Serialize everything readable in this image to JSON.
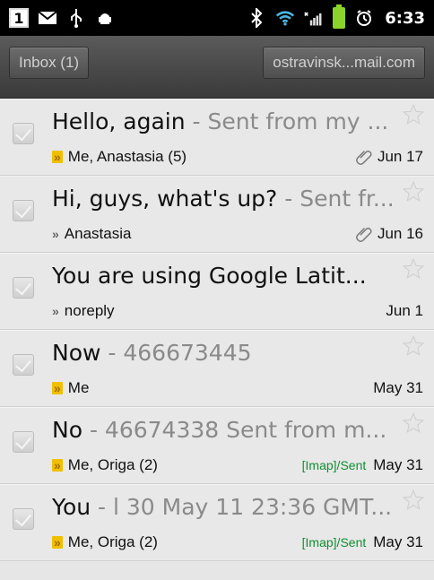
{
  "status": {
    "notif_count": "1",
    "time": "6:33"
  },
  "header": {
    "left_button": "Inbox (1)",
    "right_button": "ostravinsk...mail.com"
  },
  "messages": [
    {
      "subject": "Hello, again",
      "snippet": " - Sent from my ...",
      "senders": "Me, Anastasia (5)",
      "label": "",
      "attachment": true,
      "date": "Jun 17",
      "chevron": "highlight"
    },
    {
      "subject": "Hi, guys, what's up?",
      "snippet": " - Sent fr...",
      "senders": "Anastasia",
      "label": "",
      "attachment": true,
      "date": "Jun 16",
      "chevron": "plain"
    },
    {
      "subject": "You are using Google Latit...",
      "snippet": "",
      "senders": "noreply",
      "label": "",
      "attachment": false,
      "date": "Jun 1",
      "chevron": "plain"
    },
    {
      "subject": "Now",
      "snippet": " - 466673445",
      "senders": "Me",
      "label": "",
      "attachment": false,
      "date": "May 31",
      "chevron": "highlight"
    },
    {
      "subject": "No",
      "snippet": " - 46674338 Sent from m...",
      "senders": "Me, Origa (2)",
      "label": "[Imap]/Sent",
      "attachment": false,
      "date": "May 31",
      "chevron": "highlight"
    },
    {
      "subject": "You",
      "snippet": " - l 30 May 11 23:36 GMT...",
      "senders": "Me, Origa (2)",
      "label": "[Imap]/Sent",
      "attachment": false,
      "date": "May 31",
      "chevron": "highlight"
    }
  ]
}
